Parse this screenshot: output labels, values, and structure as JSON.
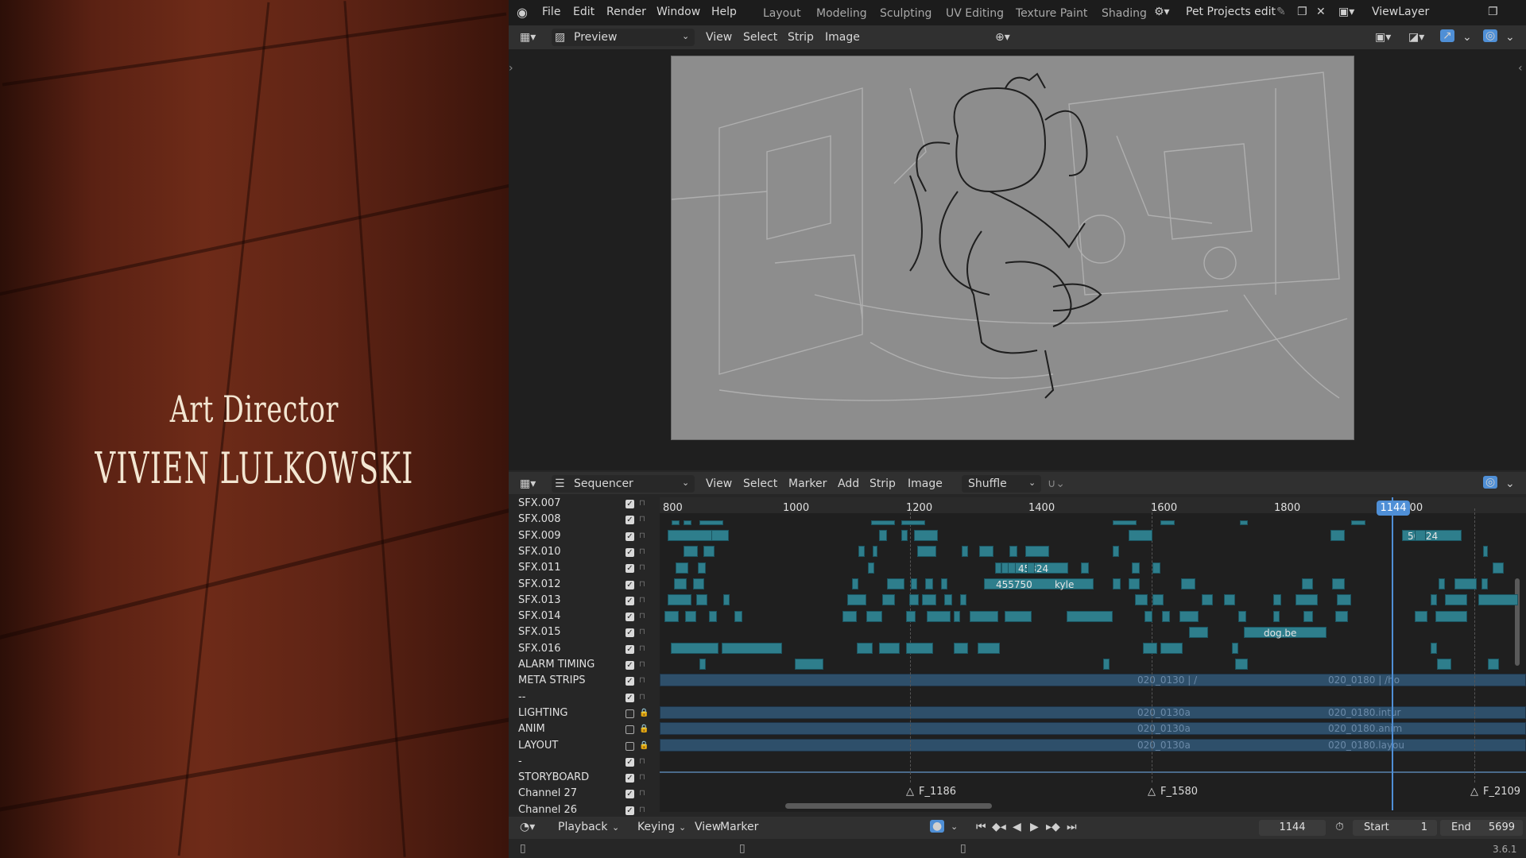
{
  "credits": {
    "role": "Art Director",
    "name": "VIVIEN LULKOWSKI"
  },
  "topbar": {
    "menus": [
      "File",
      "Edit",
      "Render",
      "Window",
      "Help"
    ],
    "workspaces": [
      "Layout",
      "Modeling",
      "Sculpting",
      "UV Editing",
      "Texture Paint",
      "Shading"
    ],
    "scene": "Pet Projects edit",
    "view_layer": "ViewLayer"
  },
  "preview_header": {
    "mode": "Preview",
    "menus": [
      "View",
      "Select",
      "Strip",
      "Image"
    ]
  },
  "sequencer_header": {
    "editor": "Sequencer",
    "menus": [
      "View",
      "Select",
      "Marker",
      "Add",
      "Strip",
      "Image"
    ],
    "shuffle": "Shuffle"
  },
  "channels": [
    {
      "name": "SFX.007",
      "checked": true,
      "locked": false
    },
    {
      "name": "SFX.008",
      "checked": true,
      "locked": false
    },
    {
      "name": "SFX.009",
      "checked": true,
      "locked": false
    },
    {
      "name": "SFX.010",
      "checked": true,
      "locked": false
    },
    {
      "name": "SFX.011",
      "checked": true,
      "locked": false
    },
    {
      "name": "SFX.012",
      "checked": true,
      "locked": false
    },
    {
      "name": "SFX.013",
      "checked": true,
      "locked": false
    },
    {
      "name": "SFX.014",
      "checked": true,
      "locked": false
    },
    {
      "name": "SFX.015",
      "checked": true,
      "locked": false
    },
    {
      "name": "SFX.016",
      "checked": true,
      "locked": false
    },
    {
      "name": "ALARM TIMING",
      "checked": true,
      "locked": false
    },
    {
      "name": "META STRIPS",
      "checked": true,
      "locked": false
    },
    {
      "name": "--",
      "checked": true,
      "locked": false
    },
    {
      "name": "LIGHTING",
      "checked": false,
      "locked": true
    },
    {
      "name": "ANIM",
      "checked": false,
      "locked": true
    },
    {
      "name": "LAYOUT",
      "checked": false,
      "locked": true
    },
    {
      "name": "-",
      "checked": true,
      "locked": false
    },
    {
      "name": "STORYBOARD",
      "checked": true,
      "locked": false
    },
    {
      "name": "Channel 27",
      "checked": true,
      "locked": false
    },
    {
      "name": "Channel 26",
      "checked": true,
      "locked": false
    }
  ],
  "ruler": {
    "labels": [
      "800",
      "1000",
      "1200",
      "1400",
      "1600",
      "1800",
      "2000"
    ],
    "current_frame": "1144"
  },
  "strip_labels": {
    "a": "50024",
    "b": "45324",
    "c": "455750",
    "d": "kyle",
    "e": "dog.be"
  },
  "meta_labels": [
    "020_0130 | /",
    "020_0180 | /ho",
    "020_0130a",
    "020_0180.intur",
    "020_0130a",
    "020_0180.anim",
    "020_0130a",
    "020_0180.layou"
  ],
  "markers": [
    "F_1186",
    "F_1580",
    "F_2109"
  ],
  "footer": {
    "menus": [
      "Playback",
      "Keying",
      "View",
      "Marker"
    ],
    "current_frame": "1144",
    "start_label": "Start",
    "start_value": "1",
    "end_label": "End",
    "end_value": "5699",
    "version": "3.6.1"
  },
  "colors": {
    "strip": "#2e7e8c",
    "meta": "#2e4f6a",
    "playhead": "#4f8fd6"
  }
}
